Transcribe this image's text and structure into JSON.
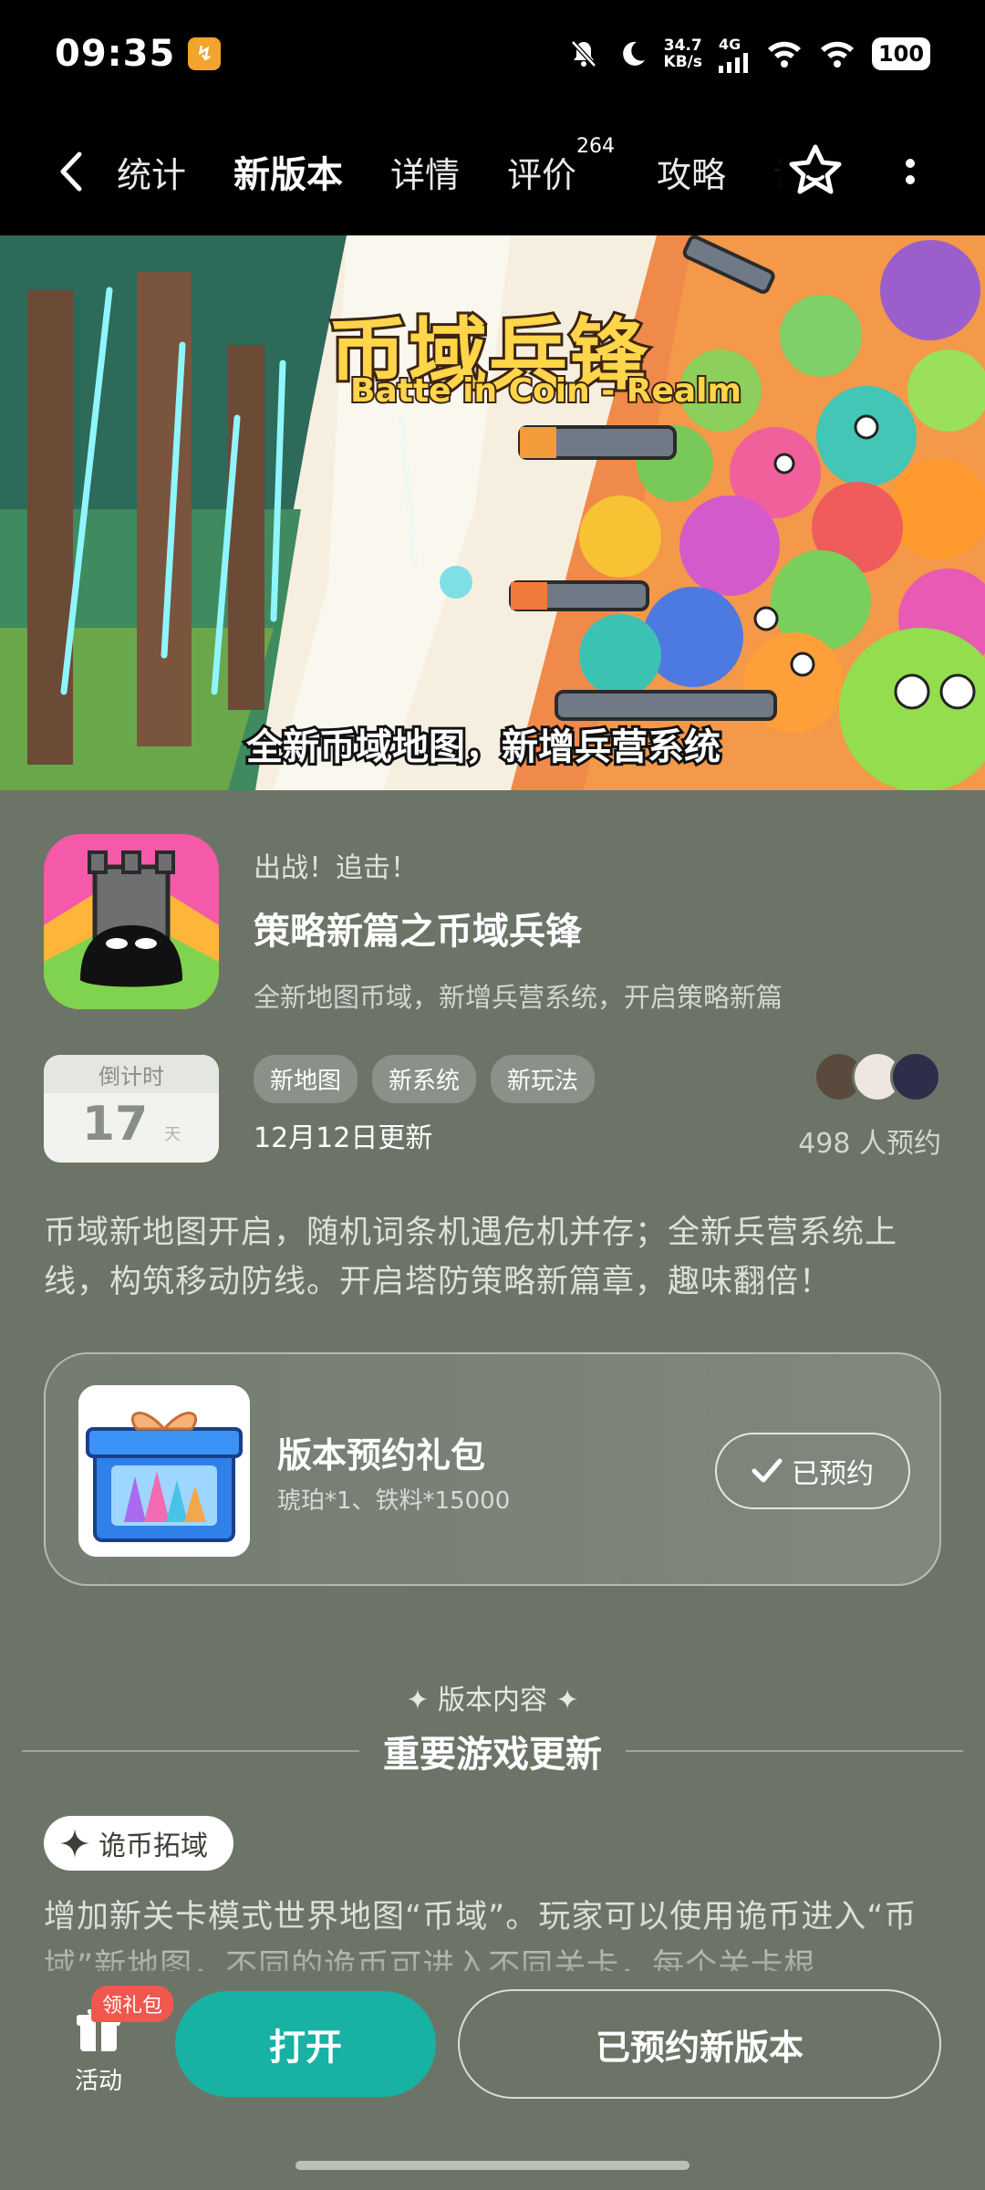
{
  "status_bar": {
    "time": "09:35",
    "net_speed_value": "34.7",
    "net_speed_unit": "KB/s",
    "network_type": "4G",
    "battery": "100"
  },
  "nav": {
    "tabs": [
      {
        "label": "统计"
      },
      {
        "label": "新版本"
      },
      {
        "label": "详情"
      },
      {
        "label": "评价",
        "badge": "264"
      },
      {
        "label": "攻略"
      },
      {
        "label": "讨"
      }
    ],
    "active_tab": "新版本"
  },
  "banner": {
    "title_cn": "币域兵锋",
    "title_en": "Batte in Coin - Realm",
    "caption": "全新币域地图，新增兵营系统"
  },
  "game": {
    "subtitle": "出战！追击！",
    "title": "策略新篇之币域兵锋",
    "description": "全新地图币域，新增兵营系统，开启策略新篇"
  },
  "countdown": {
    "label": "倒计时",
    "number": "17",
    "unit": "天"
  },
  "tags": [
    "新地图",
    "新系统",
    "新玩法"
  ],
  "update_date": "12月12日更新",
  "reserve_count": "498 人预约",
  "intro": "币域新地图开启，随机词条机遇危机并存；全新兵营系统上线，构筑移动防线。开启塔防策略新篇章，趣味翻倍！",
  "gift": {
    "title": "版本预约礼包",
    "contents": "琥珀*1、铁料*15000",
    "button": "已预约"
  },
  "section": {
    "kicker": "版本内容",
    "heading": "重要游戏更新"
  },
  "feature": {
    "pill": "诡币拓域",
    "text": "增加新关卡模式世界地图“币域”。玩家可以使用诡币进入“币域”新地图，不同的诡币可进入不同关卡，每个关卡根"
  },
  "bottom": {
    "activity_label": "活动",
    "gift_badge": "领礼包",
    "open_button": "打开",
    "reserved_button": "已预约新版本"
  },
  "colors": {
    "accent": "#17b2a3",
    "background": "#6c7468",
    "badge_red": "#f2574d"
  }
}
